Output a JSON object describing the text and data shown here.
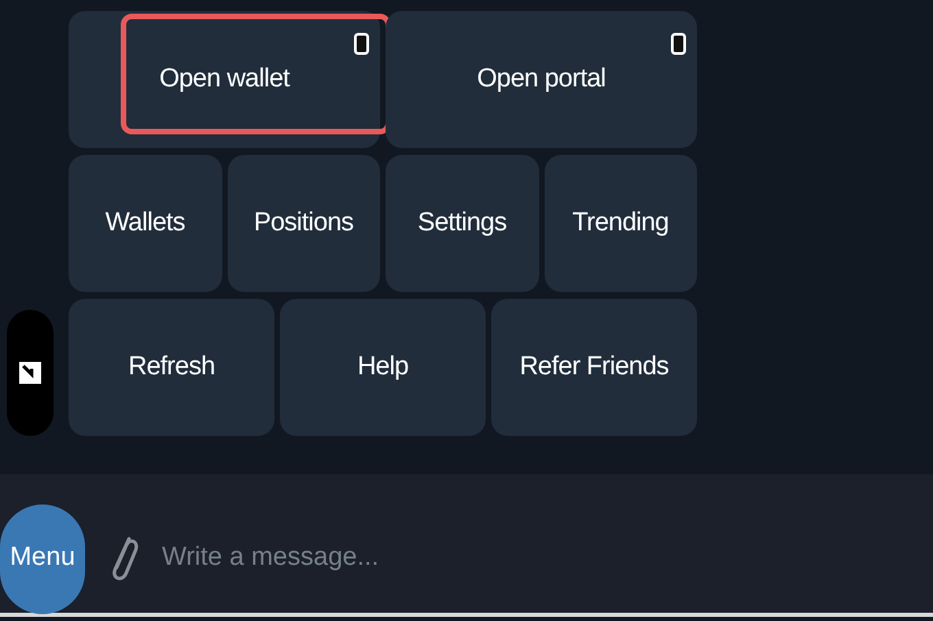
{
  "keyboard": {
    "rows": [
      {
        "buttons": [
          {
            "label": "Open wallet",
            "kind": "webapp",
            "highlighted": true
          },
          {
            "label": "Open portal",
            "kind": "webapp",
            "highlighted": false
          }
        ]
      },
      {
        "buttons": [
          {
            "label": "Wallets",
            "kind": "command",
            "highlighted": false
          },
          {
            "label": "Positions",
            "kind": "command",
            "highlighted": false
          },
          {
            "label": "Settings",
            "kind": "command",
            "highlighted": false
          },
          {
            "label": "Trending",
            "kind": "command",
            "highlighted": false
          }
        ]
      },
      {
        "buttons": [
          {
            "label": "Refresh",
            "kind": "command",
            "highlighted": false
          },
          {
            "label": "Help",
            "kind": "command",
            "highlighted": false
          },
          {
            "label": "Refer Friends",
            "kind": "command",
            "highlighted": false
          }
        ]
      }
    ]
  },
  "composer": {
    "menu_button": "Menu",
    "placeholder": "Write a message..."
  }
}
